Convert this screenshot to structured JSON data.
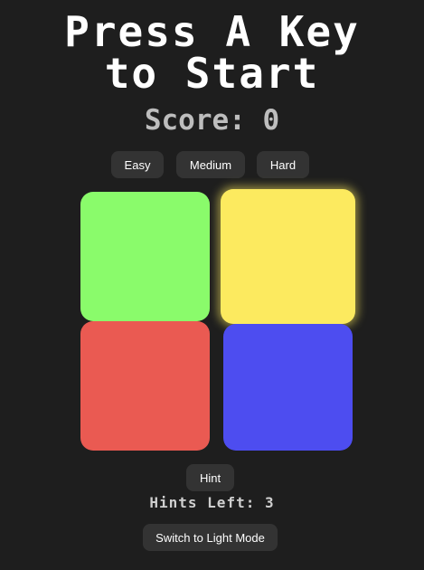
{
  "title": {
    "line1": "Press A Key",
    "line2": "to Start"
  },
  "score": {
    "text": "Score: 0"
  },
  "difficulty": {
    "easy": "Easy",
    "medium": "Medium",
    "hard": "Hard"
  },
  "pads": {
    "green": "#8afb6b",
    "yellow": "#fcea5f",
    "red": "#ea5a52",
    "blue": "#4d4df0",
    "highlighted": "yellow"
  },
  "hint": {
    "button_label": "Hint",
    "hints_left_text": "Hints Left: 3"
  },
  "theme_toggle": {
    "label": "Switch to Light Mode"
  },
  "colors": {
    "background": "#1e1e1e",
    "button": "#333333"
  }
}
